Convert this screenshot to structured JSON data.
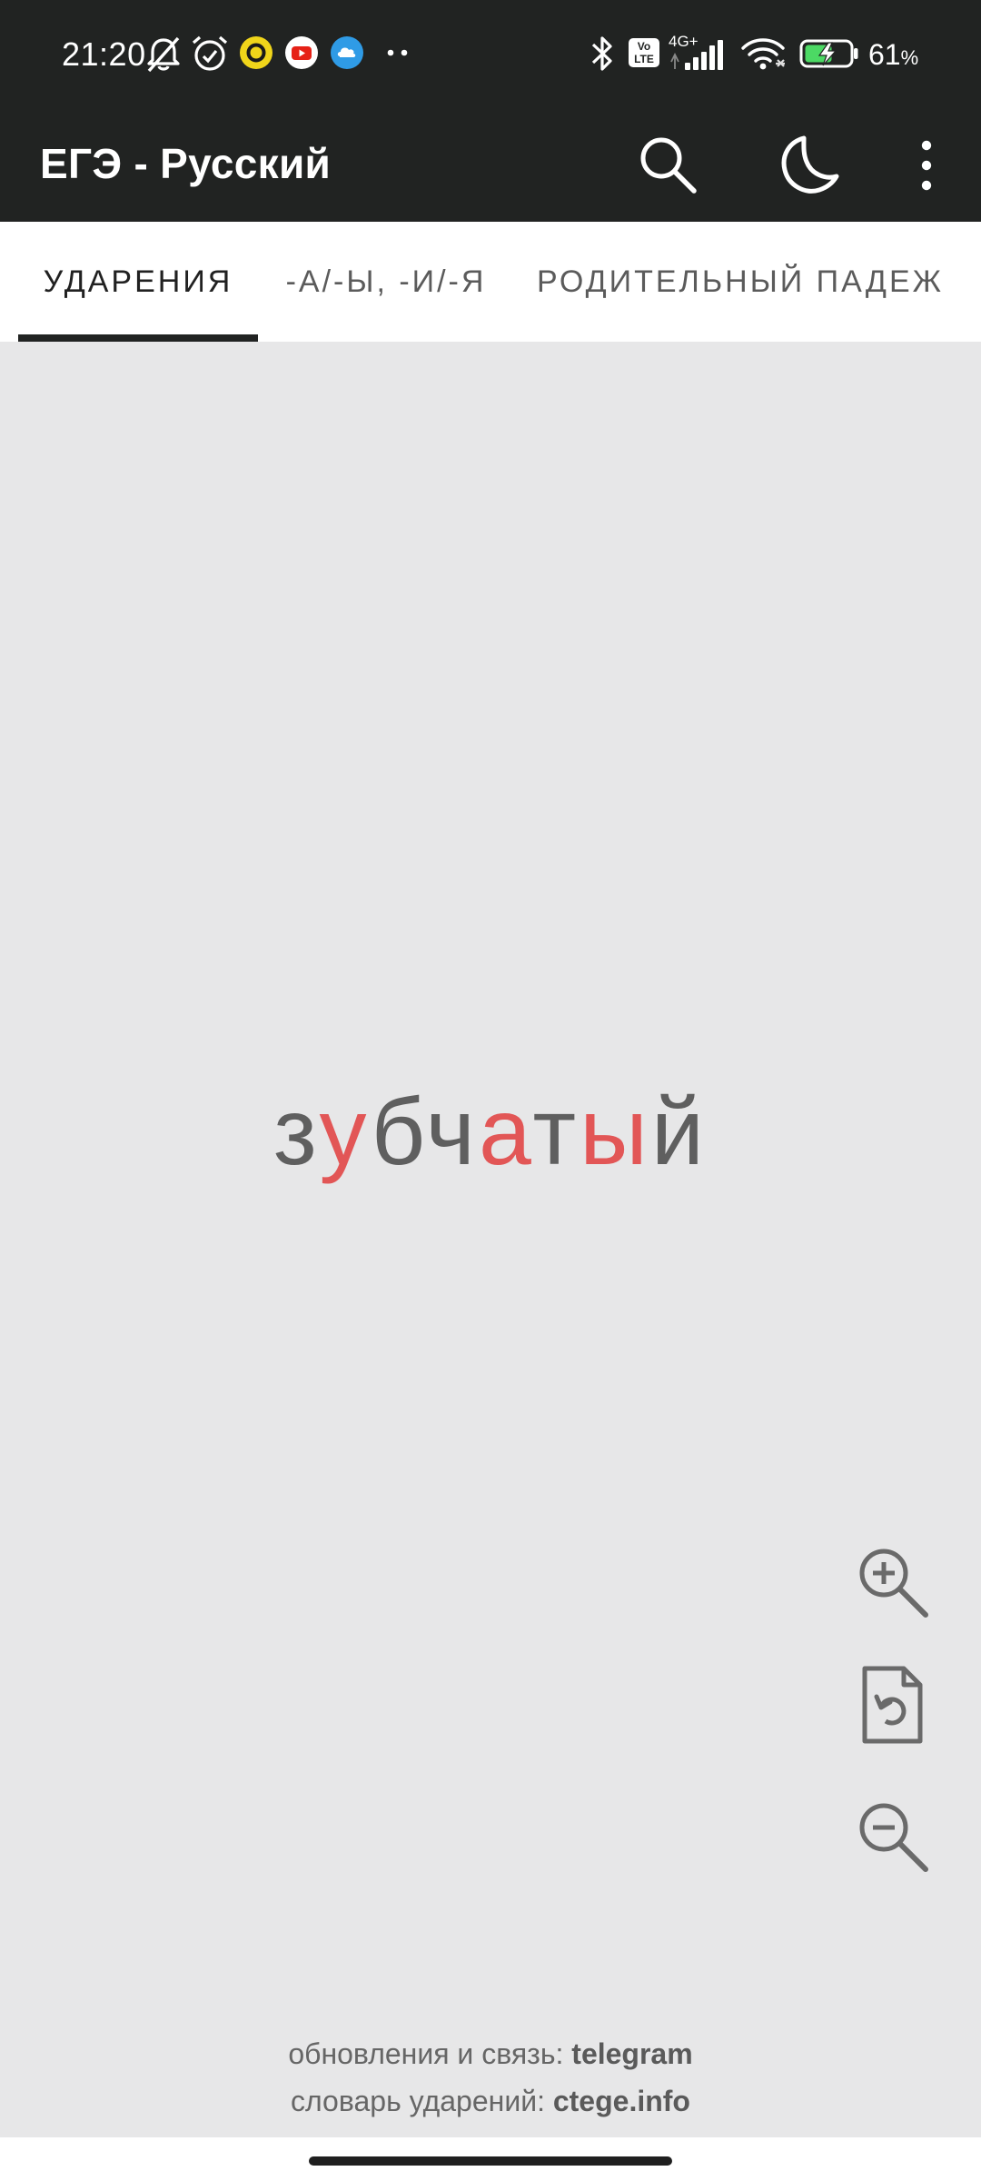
{
  "status_bar": {
    "time": "21:20",
    "network_label": "4G+",
    "volte_label": "Vo LTE",
    "battery": "61",
    "battery_unit": "%",
    "icons": [
      "bell-off-icon",
      "alarm-icon",
      "yellow-circle-app-icon",
      "youtube-icon",
      "blue-cloud-app-icon",
      "more-dots-icon",
      "bluetooth-icon",
      "volte-icon",
      "signal-icon",
      "wifi-icon",
      "battery-charging-icon"
    ]
  },
  "app_bar": {
    "title": "ЕГЭ - Русский",
    "actions": [
      "search-icon",
      "moon-icon",
      "more-vert-icon"
    ]
  },
  "tabs": [
    {
      "label": "УДАРЕНИЯ",
      "active": true
    },
    {
      "label": "-А/-Ы, -И/-Я",
      "active": false
    },
    {
      "label": "РОДИТЕЛЬНЫЙ ПАДЕЖ",
      "active": false
    }
  ],
  "card": {
    "word_parts": [
      {
        "text": "з",
        "highlight": false
      },
      {
        "text": "у",
        "highlight": true
      },
      {
        "text": "бч",
        "highlight": false
      },
      {
        "text": "а",
        "highlight": true
      },
      {
        "text": "т",
        "highlight": false
      },
      {
        "text": "ы",
        "highlight": true
      },
      {
        "text": "й",
        "highlight": false
      }
    ]
  },
  "controls": {
    "zoom_in": "zoom-in-icon",
    "reset": "reset-icon",
    "zoom_out": "zoom-out-icon"
  },
  "footer": {
    "line1_text": "обновления и связь: ",
    "line1_link": "telegram",
    "line2_text": "словарь ударений: ",
    "line2_link": "ctege.info"
  },
  "colors": {
    "toolbar_bg": "#212322",
    "content_bg": "#e7e7e8",
    "word_gray": "#5f5f5f",
    "accent_red": "#e25656"
  }
}
